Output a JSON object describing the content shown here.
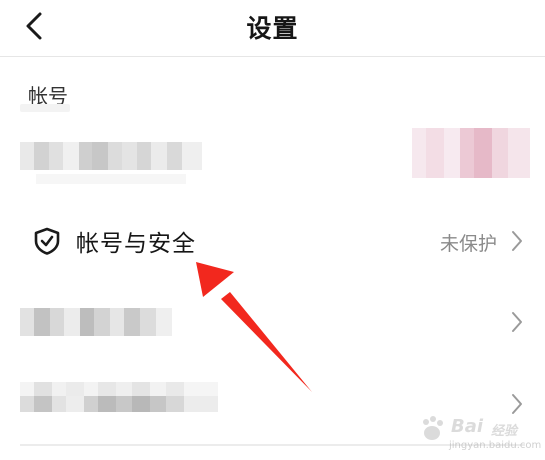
{
  "header": {
    "title": "设置",
    "back_icon": "chevron-left-icon"
  },
  "section": {
    "label": "帐号"
  },
  "security_row": {
    "icon": "shield-check-icon",
    "title": "帐号与安全",
    "status": "未保护",
    "chevron_icon": "chevron-right-icon"
  },
  "annotation": {
    "color": "#f2281e"
  },
  "watermark": {
    "brand": "Bai",
    "logo_glyph": "du",
    "sub": "jingyan.baidu.com",
    "side": "经验"
  },
  "colors": {
    "accent": "#f2281e",
    "text": "#161616",
    "muted": "#8a8a8a",
    "divider": "#e6e6e6"
  }
}
